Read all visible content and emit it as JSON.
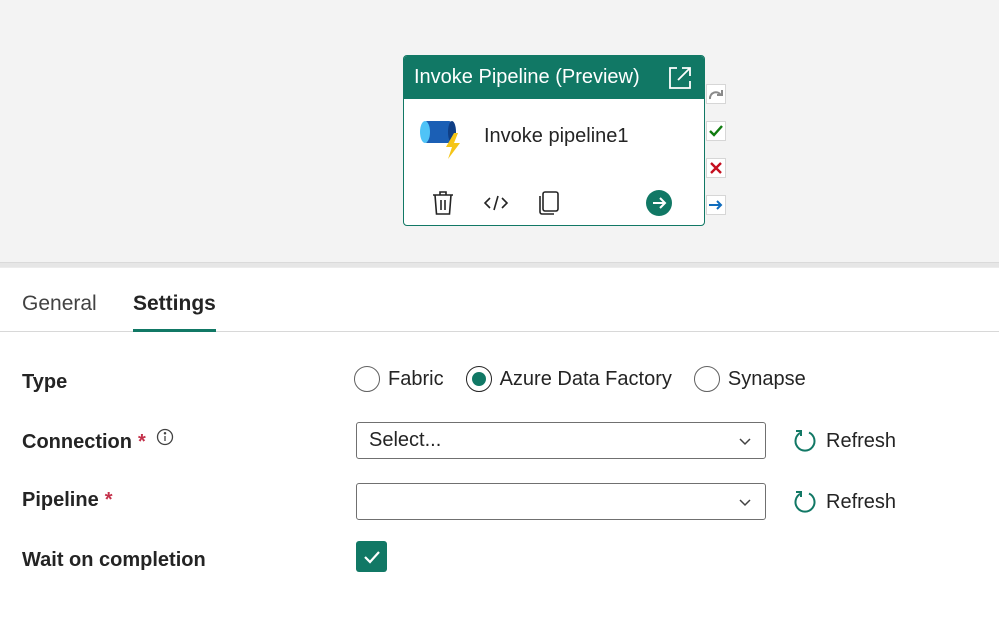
{
  "activity": {
    "header_title": "Invoke Pipeline (Preview)",
    "name": "Invoke pipeline1",
    "accent_color": "#117865",
    "icons": {
      "open": "open-external-icon",
      "main": "invoke-pipeline-icon",
      "delete": "trash-icon",
      "code": "code-icon",
      "copy": "copy-icon",
      "go": "arrow-right-circle-icon"
    }
  },
  "ports": [
    "skip-arrow-icon",
    "success-check-icon",
    "fail-x-icon",
    "completion-arrow-icon"
  ],
  "tabs": [
    {
      "label": "General",
      "active": false
    },
    {
      "label": "Settings",
      "active": true
    }
  ],
  "form": {
    "type": {
      "label": "Type",
      "options": [
        "Fabric",
        "Azure Data Factory",
        "Synapse"
      ],
      "selected": "Azure Data Factory"
    },
    "connection": {
      "label": "Connection",
      "required_mark": "*",
      "value": "Select...",
      "refresh_label": "Refresh"
    },
    "pipeline": {
      "label": "Pipeline",
      "required_mark": "*",
      "value": "",
      "refresh_label": "Refresh"
    },
    "wait_on_completion": {
      "label": "Wait on completion",
      "checked": true
    }
  }
}
